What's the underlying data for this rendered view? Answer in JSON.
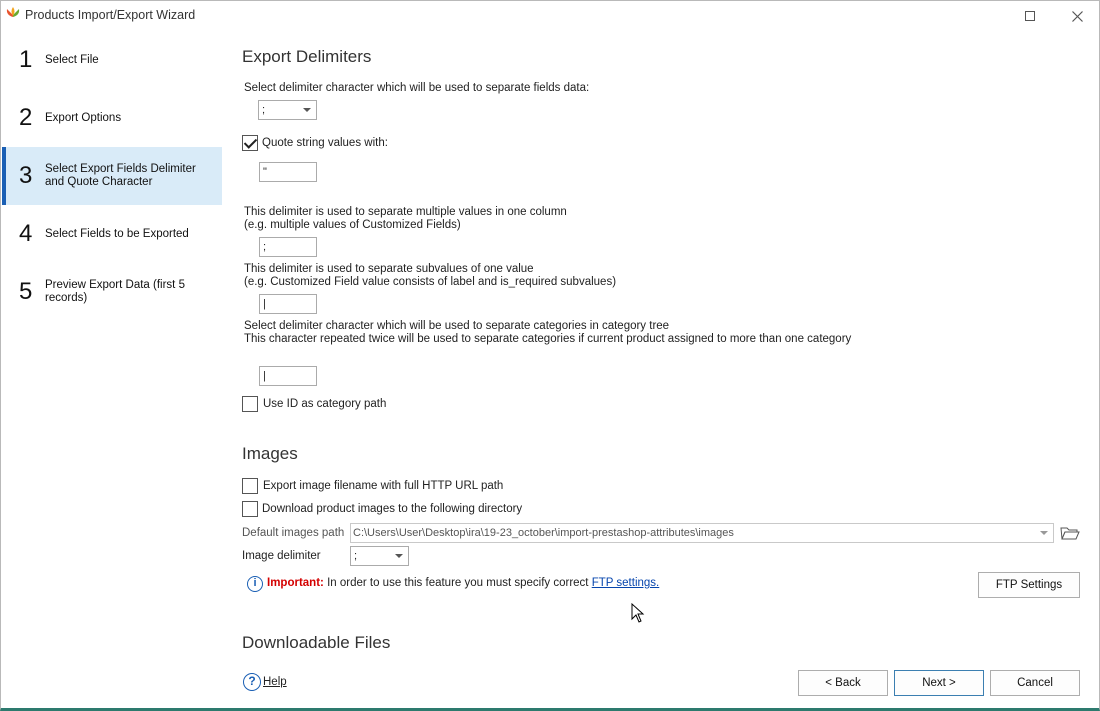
{
  "window": {
    "title": "Products Import/Export Wizard",
    "accent_color": "#1a5fb4",
    "active_step_bg": "#d9ebf8"
  },
  "steps": [
    {
      "number": "1",
      "label": "Select File",
      "active": false
    },
    {
      "number": "2",
      "label": "Export Options",
      "active": false
    },
    {
      "number": "3",
      "label": "Select Export Fields Delimiter and Quote Character",
      "active": true
    },
    {
      "number": "4",
      "label": "Select Fields to be Exported",
      "active": false
    },
    {
      "number": "5",
      "label": "Preview Export Data (first 5 records)",
      "active": false
    }
  ],
  "export_delimiters": {
    "title": "Export Delimiters",
    "field_delimiter_label": "Select delimiter character which will be used to separate fields data:",
    "field_delimiter_value": ";",
    "quote_checkbox_label": "Quote string values with:",
    "quote_checked": true,
    "quote_value": "\"",
    "multi_value_label_1": "This delimiter is used to separate multiple values in one column",
    "multi_value_label_2": "(e.g. multiple values of Customized Fields)",
    "multi_value_value": ";",
    "subvalue_label_1": "This delimiter is used to separate subvalues of one value",
    "subvalue_label_2": "(e.g. Customized Field value consists of label and is_required subvalues)",
    "subvalue_value": "|",
    "category_label_1": "Select delimiter character which will be used to separate categories in category tree",
    "category_label_2": "This character repeated twice will be used to separate categories if current product assigned to more than one category",
    "category_value": "|",
    "use_id_label": "Use ID as category path",
    "use_id_checked": false
  },
  "images": {
    "title": "Images",
    "export_full_url_label": "Export image filename with full HTTP URL path",
    "download_images_label": "Download product images to the following directory",
    "default_path_label": "Default images path",
    "default_path_value": "C:\\Users\\User\\Desktop\\ira\\19-23_october\\import-prestashop-attributes\\images",
    "image_delimiter_label": "Image delimiter",
    "image_delimiter_value": ";",
    "important_label": "Important:",
    "important_text": "In order to use this feature you must specify correct",
    "ftp_link": "FTP settings.",
    "ftp_button": "FTP Settings"
  },
  "downloadable": {
    "title": "Downloadable Files"
  },
  "footer": {
    "help": "Help",
    "back": "< Back",
    "next": "Next >",
    "cancel": "Cancel"
  },
  "icons": {
    "app": "app-logo-icon",
    "info": "info-icon",
    "help": "help-icon",
    "folder": "folder-open-icon"
  }
}
